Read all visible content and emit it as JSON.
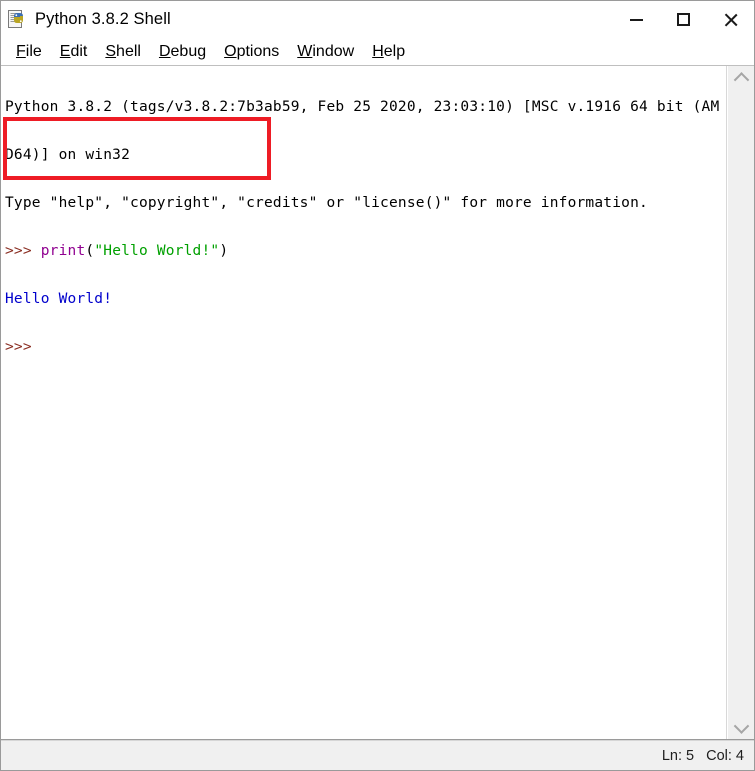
{
  "window": {
    "title": "Python 3.8.2 Shell",
    "icon": "python-idle-icon",
    "controls": {
      "minimize_label": "Minimize",
      "maximize_label": "Maximize",
      "close_label": "Close"
    }
  },
  "menu": {
    "items": [
      {
        "label": "File",
        "accel": "F",
        "rest": "ile"
      },
      {
        "label": "Edit",
        "accel": "E",
        "rest": "dit"
      },
      {
        "label": "Shell",
        "accel": "S",
        "rest": "hell"
      },
      {
        "label": "Debug",
        "accel": "D",
        "rest": "ebug"
      },
      {
        "label": "Options",
        "accel": "O",
        "rest": "ptions"
      },
      {
        "label": "Window",
        "accel": "W",
        "rest": "indow"
      },
      {
        "label": "Help",
        "accel": "H",
        "rest": "elp"
      }
    ]
  },
  "shell": {
    "banner_line_1": "Python 3.8.2 (tags/v3.8.2:7b3ab59, Feb 25 2020, 23:03:10) [MSC v.1916 64 bit (AM",
    "banner_line_2": "D64)] on win32",
    "banner_line_3": "Type \"help\", \"copyright\", \"credits\" or \"license()\" for more information.",
    "prompt": ">>> ",
    "command_keyword": "print",
    "command_open_paren": "(",
    "command_string": "\"Hello World!\"",
    "command_close_paren": ")",
    "output_line": "Hello World!",
    "trailing_prompt": ">>>",
    "colors": {
      "prompt": "#8b2f23",
      "keyword": "#900090",
      "string": "#00a000",
      "output": "#0000cc",
      "banner": "#000000",
      "background": "#ffffff"
    }
  },
  "annotation": {
    "name": "red-highlight-box",
    "color": "#ee1c25"
  },
  "scrollbar": {
    "up_arrow": "chevron-up-icon",
    "down_arrow": "chevron-down-icon"
  },
  "status_bar": {
    "line_label": "Ln: 5",
    "col_label": "Col: 4"
  }
}
